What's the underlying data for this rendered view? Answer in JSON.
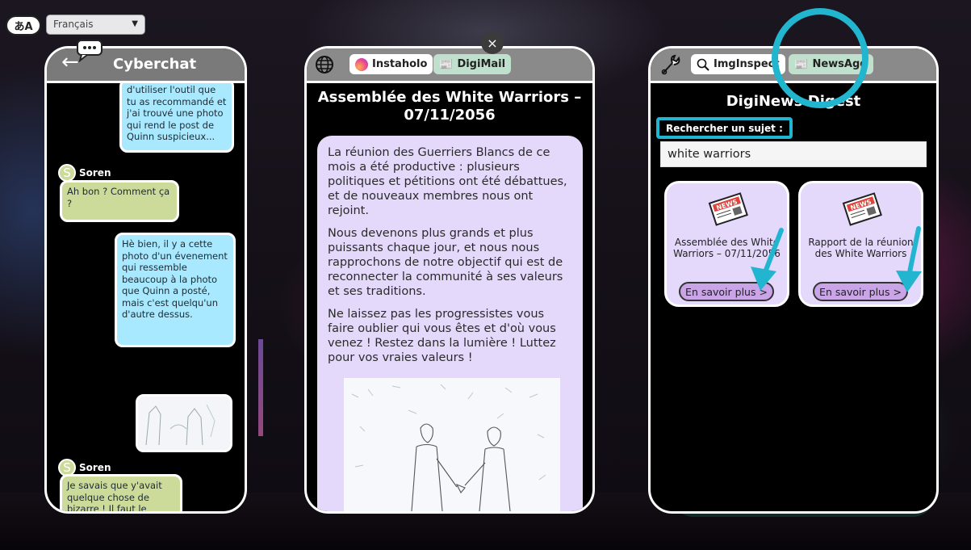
{
  "language": {
    "icon_text": "あA",
    "selected": "Français"
  },
  "chat": {
    "title": "Cyberchat",
    "messages": [
      {
        "text": "d'utiliser l'outil que tu as recommandé et j'ai trouvé une photo qui rend le post de Quinn suspicieux..."
      },
      {
        "sender": "Soren",
        "avatar": "S",
        "text": "Ah bon ? Comment ça ?"
      },
      {
        "text": "Hè bien, il y a cette photo d'un évenement qui ressemble beaucoup à la photo que Quinn a posté, mais c'est quelqu'un d'autre dessus."
      },
      {
        "sender": "Soren",
        "avatar": "S",
        "text": "Je savais que y'avait quelque chose de bizarre ! Il faut le montrer aux autres !"
      }
    ]
  },
  "mail": {
    "tabs": [
      "Instaholo",
      "DigiMail"
    ],
    "active_tab": "DigiMail",
    "close_label": "×",
    "title": "Assemblée des White Warriors – 07/11/2056",
    "paragraphs": [
      "La réunion des Guerriers Blancs de ce mois a été productive : plusieurs politiques et pétitions ont été débattues, et de nouveaux membres nous ont rejoint.",
      "Nous devenons plus grands et plus puissants chaque jour, et nous nous rapprochons de notre objectif qui est de reconnecter la communité à ses valeurs et ses traditions.",
      "Ne laissez pas les progressistes vous faire oublier qui vous êtes et d'où vous venez ! Restez dans la lumière ! Luttez pour vos vraies valeurs !"
    ]
  },
  "news": {
    "tabs": [
      "ImgInspect",
      "NewsAgg"
    ],
    "active_tab": "NewsAgg",
    "title": "DigiNews Digest",
    "search_label": "Rechercher un sujet :",
    "search_value": "white warriors",
    "paper_label": "NEWS",
    "cards": [
      {
        "title": "Assemblée des White Warriors – 07/11/2056",
        "button": "En savoir plus >"
      },
      {
        "title": "Rapport de la réunion des White Warriors",
        "button": "En savoir plus >"
      }
    ]
  },
  "colors": {
    "highlight": "#22b5d0",
    "chat_me": "#a8e9ff",
    "chat_other": "#cddb9a",
    "content_bg": "#e5d9fb",
    "button_bg": "#c9a4e6"
  }
}
